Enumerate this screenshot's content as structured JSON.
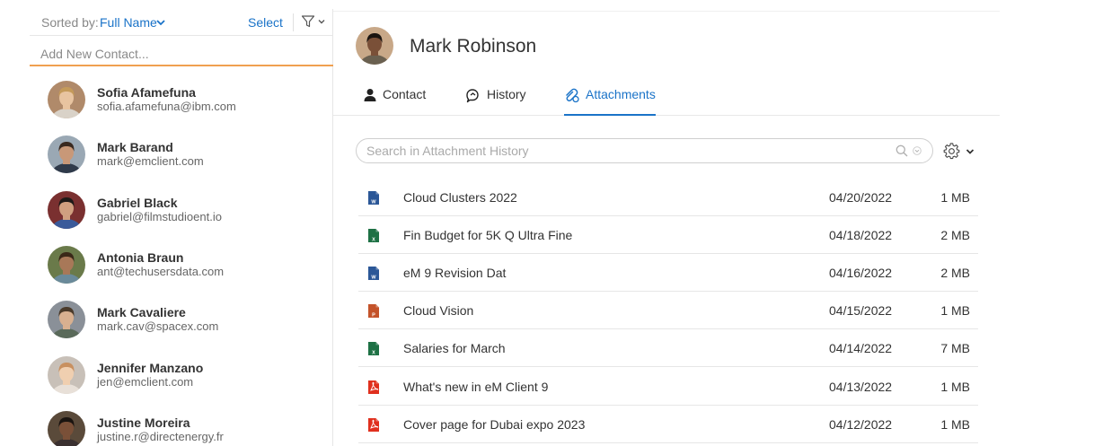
{
  "sort_bar": {
    "label": "Sorted by:",
    "value": "Full Name",
    "select_label": "Select"
  },
  "add_contact": {
    "placeholder": "Add New Contact..."
  },
  "contacts": [
    {
      "name": "Sofia Afamefuna",
      "email": "sofia.afamefuna@ibm.com",
      "avatar_bg": "#b08a6a",
      "hair": "#c49a5a",
      "skin": "#e8c4a0",
      "shirt": "#d9d2c8"
    },
    {
      "name": "Mark Barand",
      "email": "mark@emclient.com",
      "avatar_bg": "#9aa8b4",
      "hair": "#3a2a20",
      "skin": "#c89878",
      "shirt": "#2f3a4a"
    },
    {
      "name": "Gabriel Black",
      "email": "gabriel@filmstudioent.io",
      "avatar_bg": "#7a3030",
      "hair": "#1e1a18",
      "skin": "#d0a080",
      "shirt": "#3a5a9a"
    },
    {
      "name": "Antonia Braun",
      "email": "ant@techusersdata.com",
      "avatar_bg": "#6a7a4a",
      "hair": "#3a2818",
      "skin": "#a87858",
      "shirt": "#6a8a9a"
    },
    {
      "name": "Mark Cavaliere",
      "email": "mark.cav@spacex.com",
      "avatar_bg": "#8a9098",
      "hair": "#4a3a2a",
      "skin": "#d8b090",
      "shirt": "#5a6a5a"
    },
    {
      "name": "Jennifer Manzano",
      "email": "jen@emclient.com",
      "avatar_bg": "#c8c0b8",
      "hair": "#c89060",
      "skin": "#f0cfb0",
      "shirt": "#e8e0d8"
    },
    {
      "name": "Justine Moreira",
      "email": "justine.r@directenergy.fr",
      "avatar_bg": "#5a4a3a",
      "hair": "#1a1410",
      "skin": "#7a5038",
      "shirt": "#3a3030"
    }
  ],
  "detail": {
    "name": "Mark Robinson",
    "avatar": {
      "avatar_bg": "#c8a888",
      "hair": "#1a1410",
      "skin": "#7a5038",
      "shirt": "#6a6050"
    }
  },
  "tabs": [
    {
      "label": "Contact",
      "icon": "person-icon",
      "active": false
    },
    {
      "label": "History",
      "icon": "history-icon",
      "active": false
    },
    {
      "label": "Attachments",
      "icon": "attachments-icon",
      "active": true
    }
  ],
  "attachments_search": {
    "placeholder": "Search in Attachment History"
  },
  "attachments": [
    {
      "name": "Cloud Clusters 2022",
      "date": "04/20/2022",
      "size": "1 MB",
      "type": "word",
      "icon": "word-file-icon"
    },
    {
      "name": "Fin Budget for 5K Q Ultra Fine",
      "date": "04/18/2022",
      "size": "2 MB",
      "type": "excel",
      "icon": "excel-file-icon"
    },
    {
      "name": "eM 9 Revision Dat",
      "date": "04/16/2022",
      "size": "2 MB",
      "type": "word",
      "icon": "word-file-icon"
    },
    {
      "name": "Cloud Vision",
      "date": "04/15/2022",
      "size": "1 MB",
      "type": "powerpoint",
      "icon": "powerpoint-file-icon"
    },
    {
      "name": "Salaries for March",
      "date": "04/14/2022",
      "size": "7 MB",
      "type": "excel",
      "icon": "excel-file-icon"
    },
    {
      "name": "What's new in eM Client 9",
      "date": "04/13/2022",
      "size": "1 MB",
      "type": "pdf",
      "icon": "pdf-file-icon"
    },
    {
      "name": "Cover page for Dubai expo 2023",
      "date": "04/12/2022",
      "size": "1 MB",
      "type": "pdf",
      "icon": "pdf-file-icon"
    }
  ],
  "colors": {
    "accent": "#1a73c8",
    "input_underline": "#f0a050",
    "word": "#2b5797",
    "excel": "#1e7145",
    "powerpoint": "#c4532a",
    "pdf": "#e0301e"
  }
}
